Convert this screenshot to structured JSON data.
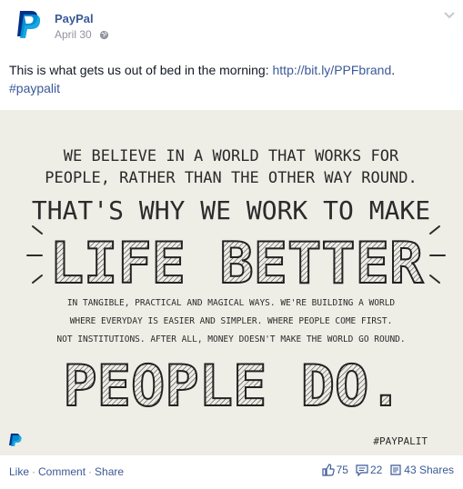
{
  "post": {
    "page_name": "PayPal",
    "date": "April 30",
    "text_before_link": "This is what gets us out of bed in the morning: ",
    "link": "http://bit.ly/PPFbrand",
    "text_after_link": ".",
    "hashtag": "#paypalit"
  },
  "image": {
    "line1": "WE BELIEVE IN A WORLD THAT WORKS FOR",
    "line2": "PEOPLE, RATHER THAN THE OTHER WAY ROUND.",
    "line3": "THAT'S WHY WE WORK TO MAKE",
    "headline1": "LIFE BETTER",
    "para1": "IN TANGIBLE, PRACTICAL AND MAGICAL WAYS. WE'RE BUILDING A WORLD",
    "para2": "WHERE EVERYDAY IS EASIER AND SIMPLER. WHERE PEOPLE COME FIRST.",
    "para3": "NOT INSTITUTIONS. AFTER ALL, MONEY DOESN'T MAKE THE WORLD GO ROUND.",
    "headline2": "PEOPLE DO.",
    "tag": "#PAYPALIT"
  },
  "footer": {
    "like": "Like",
    "comment": "Comment",
    "share": "Share",
    "likes_count": "75",
    "comments_count": "22",
    "shares_count": "43 Shares"
  },
  "colors": {
    "link": "#3b5998",
    "paypal_dark": "#003087",
    "paypal_light": "#009cde",
    "image_bg": "#eeede6"
  }
}
